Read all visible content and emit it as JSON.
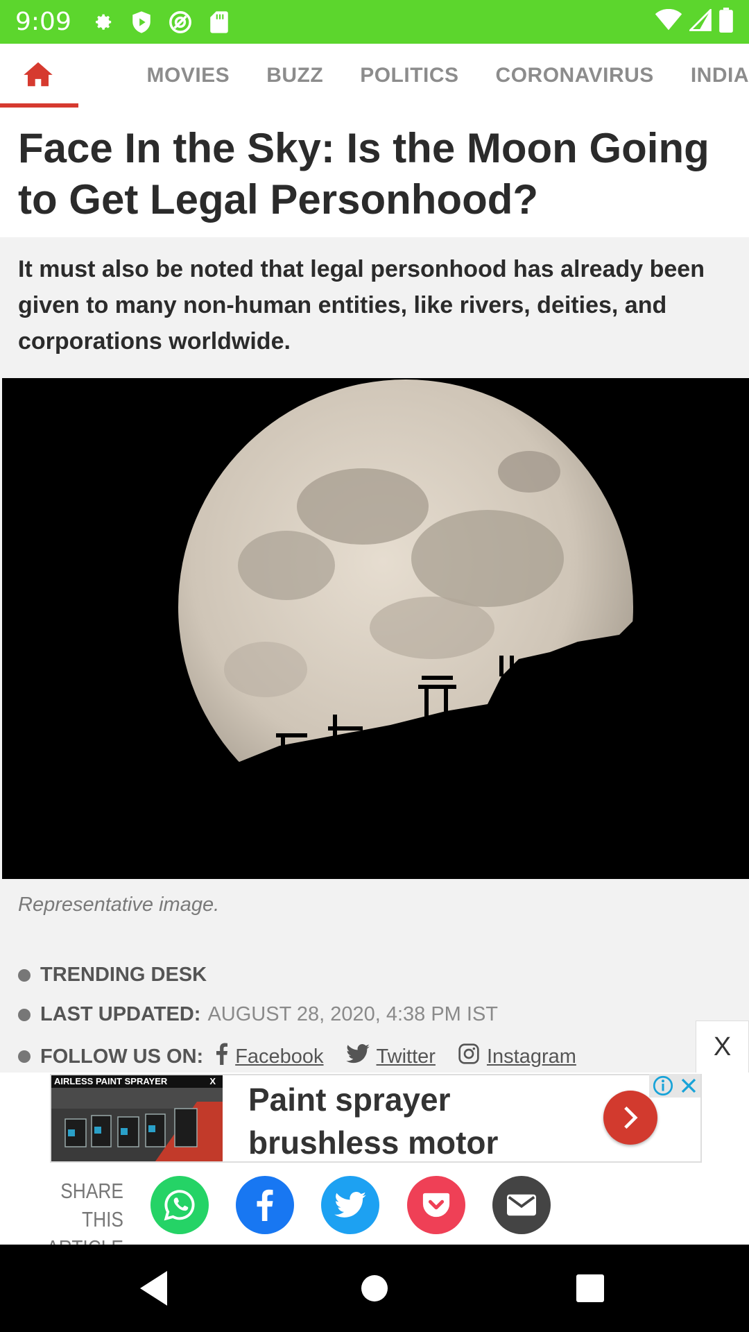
{
  "status_bar": {
    "time": "9:09"
  },
  "nav": {
    "tabs": [
      {
        "label": "MOVIES"
      },
      {
        "label": "BUZZ"
      },
      {
        "label": "POLITICS"
      },
      {
        "label": "CORONAVIRUS"
      },
      {
        "label": "INDIA"
      }
    ],
    "active_color": "#d63a2f"
  },
  "article": {
    "headline": "Face In the Sky: Is the Moon Going to Get Legal Personhood?",
    "summary": "It must also be noted that legal personhood has already been given to many non-human entities, like rivers, deities, and corporations worldwide.",
    "image_caption": "Representative image.",
    "meta": {
      "author": "TRENDING DESK",
      "updated_label": "LAST UPDATED:",
      "updated_value": "AUGUST 28, 2020, 4:38 PM IST",
      "follow_label": "FOLLOW US ON:",
      "social": {
        "facebook": "Facebook",
        "twitter": "Twitter",
        "instagram": "Instagram"
      }
    }
  },
  "floating_close": "X",
  "ad": {
    "image_header": "AIRLESS PAINT SPRAYER",
    "image_close": "X",
    "text_line1": "Paint sprayer",
    "text_line2": "brushless motor"
  },
  "share": {
    "label_line1": "SHARE THIS",
    "label_line2": "ARTICLE",
    "buttons": [
      {
        "name": "whatsapp",
        "color": "#25d366"
      },
      {
        "name": "facebook",
        "color": "#1877f2"
      },
      {
        "name": "twitter",
        "color": "#1da1f2"
      },
      {
        "name": "pocket",
        "color": "#ef4056"
      },
      {
        "name": "email",
        "color": "#444444"
      }
    ]
  },
  "colors": {
    "status_bar": "#5cd62d",
    "accent": "#d63a2f"
  }
}
